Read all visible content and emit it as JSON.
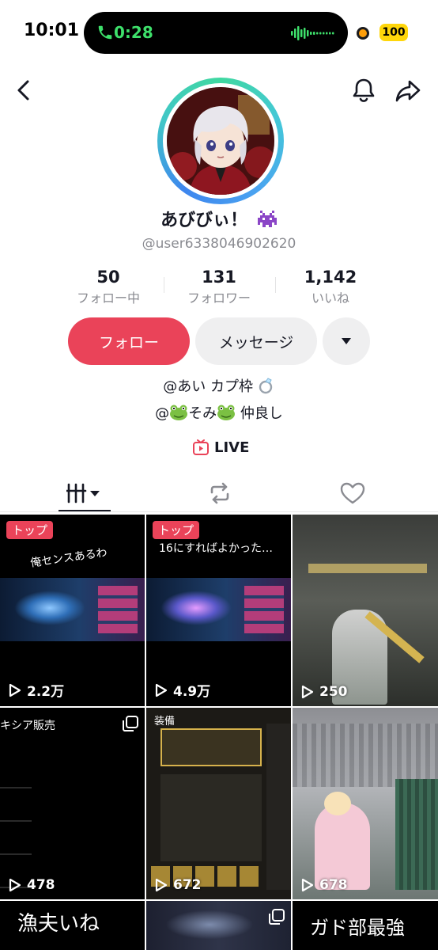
{
  "status_bar": {
    "time": "10:01",
    "call_timer": "0:28",
    "battery": "100"
  },
  "profile": {
    "display_name": "あびびぃ！",
    "username": "@user6338046902620",
    "stats": [
      {
        "value": "50",
        "label": "フォロー中"
      },
      {
        "value": "131",
        "label": "フォロワー"
      },
      {
        "value": "1,142",
        "label": "いいね"
      }
    ],
    "follow_label": "フォロー",
    "message_label": "メッセージ",
    "bio_line1_prefix": "@あい カプ枠",
    "bio_line2_prefix": "@",
    "bio_line2_mid": "そみ",
    "bio_line2_suffix": " 仲良し",
    "live_label": "LIVE"
  },
  "colors": {
    "accent": "#ea4359",
    "call_green": "#3ee06b",
    "battery": "#ffd60a"
  },
  "videos": [
    {
      "badge": "トップ",
      "caption": "俺センスあるわ",
      "views": "2.2万"
    },
    {
      "badge": "トップ",
      "caption": "16にすればよかった…",
      "views": "4.9万"
    },
    {
      "badge": "",
      "caption": "",
      "views": "250"
    },
    {
      "badge": "",
      "caption": "キシア販売",
      "views": "478"
    },
    {
      "badge": "",
      "caption": "装備",
      "views": "672"
    },
    {
      "badge": "",
      "caption": "",
      "views": "678"
    },
    {
      "badge": "",
      "caption": "漁夫いね",
      "views": ""
    },
    {
      "badge": "",
      "caption": "",
      "views": ""
    },
    {
      "badge": "",
      "caption": "ガド部最強",
      "views": ""
    }
  ]
}
